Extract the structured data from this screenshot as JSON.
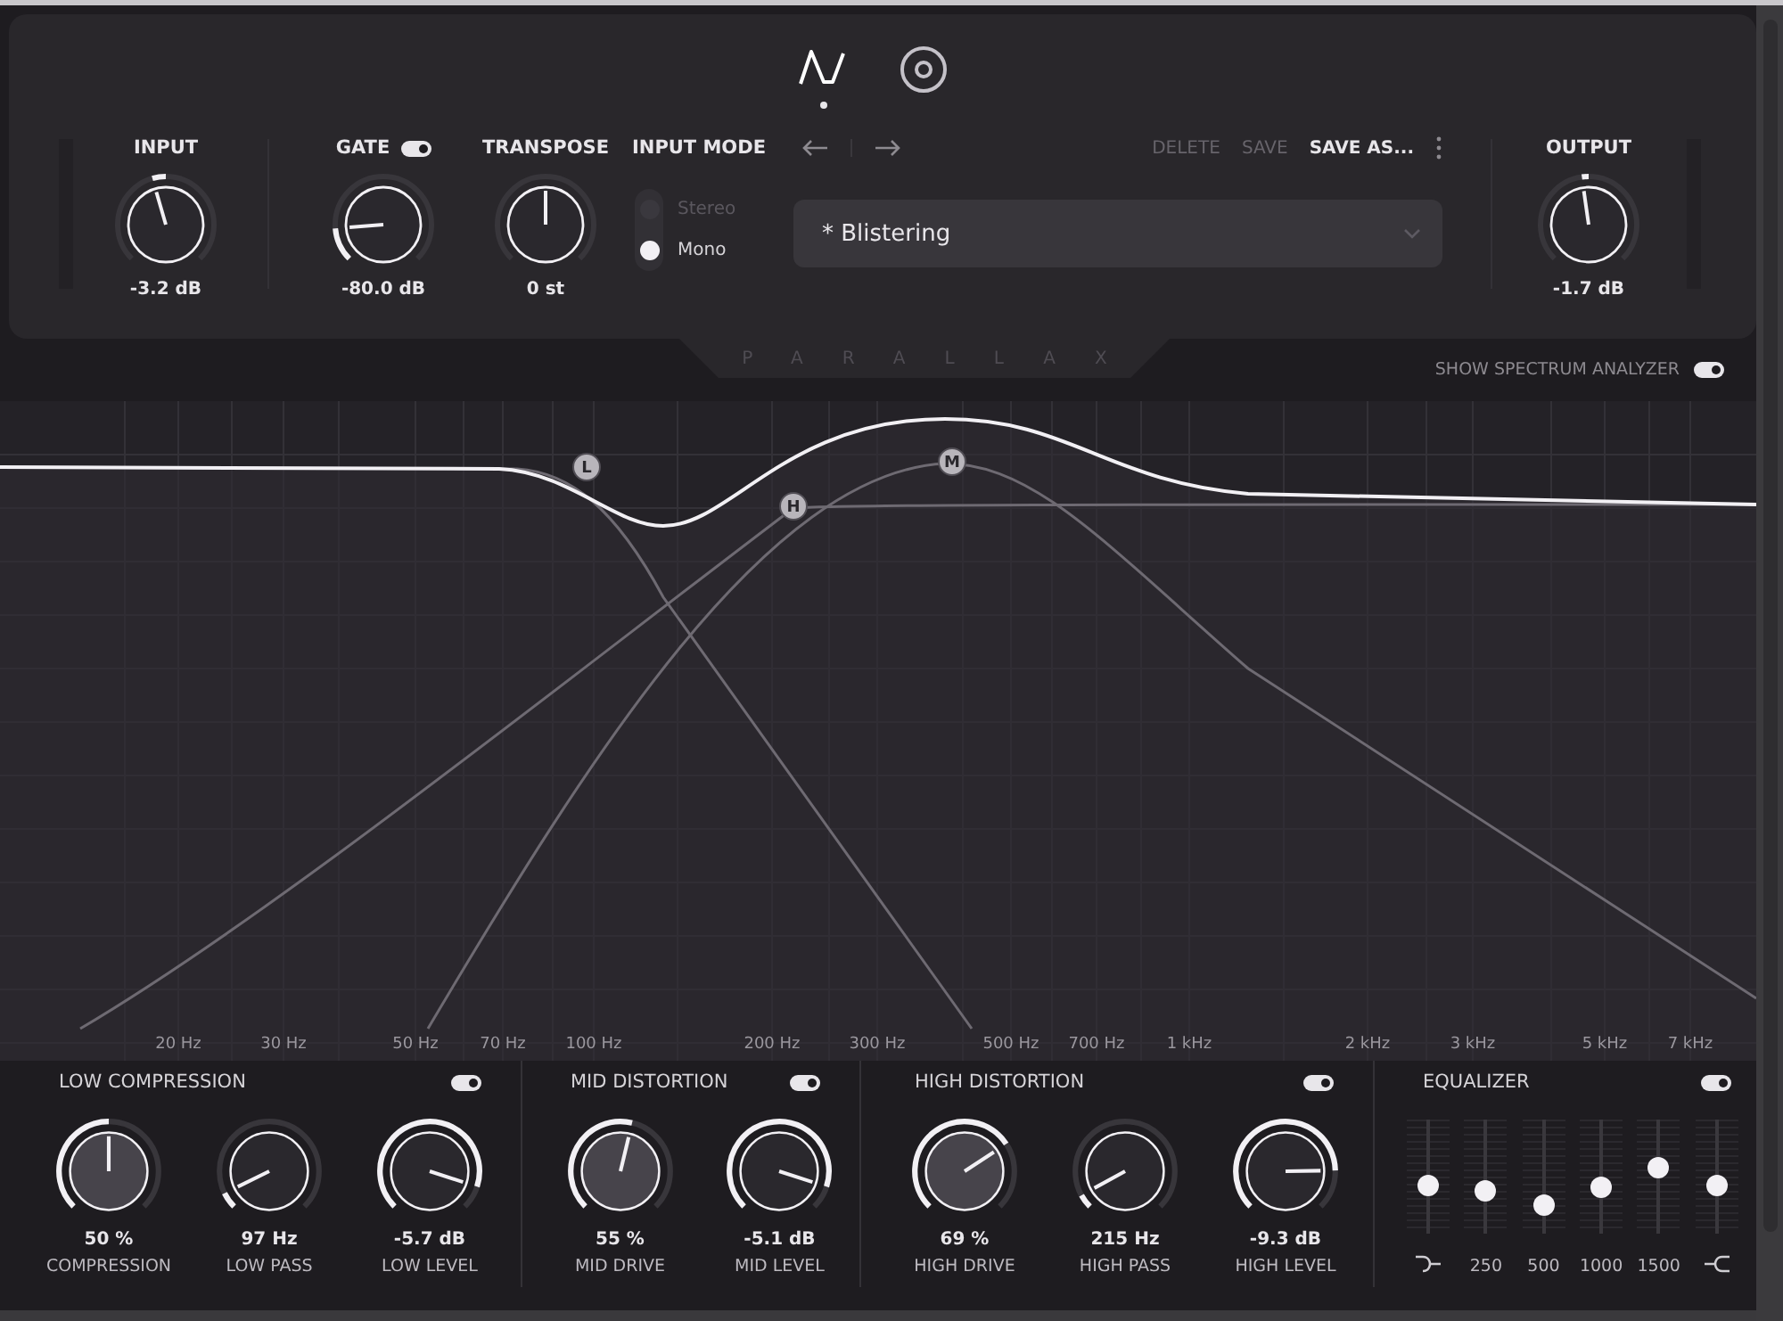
{
  "views": [
    {
      "kind": "wave",
      "selected": true
    },
    {
      "kind": "target",
      "selected": false
    }
  ],
  "gate_switch": {
    "on": true
  },
  "input_knobs": [
    {
      "label": "INPUT",
      "value": "-3.2 dB",
      "kind": "bipolar"
    },
    {
      "label": "GATE",
      "value": "-80.0 dB",
      "kind": "unipolar"
    },
    {
      "label": "TRANSPOSE",
      "value": "0 st",
      "kind": "bipolar"
    }
  ],
  "input_mode": {
    "label": "INPUT MODE",
    "options": [
      {
        "label": "Stereo",
        "selected": false
      },
      {
        "label": "Mono",
        "selected": true
      }
    ]
  },
  "preset": {
    "name": "* Blistering",
    "actions": [
      {
        "label": "DELETE",
        "disabled": true
      },
      {
        "label": "SAVE",
        "disabled": true
      },
      {
        "label": "SAVE AS...",
        "disabled": false
      }
    ]
  },
  "output_knob": {
    "label": "OUTPUT",
    "value": "-1.7 dB",
    "kind": "bipolar"
  },
  "brand": "PARALLAX",
  "spectrum_toggle": {
    "label": "SHOW SPECTRUM ANALYZER",
    "on": true
  },
  "graph": {
    "bands": [
      {
        "label": "L"
      },
      {
        "label": "H"
      },
      {
        "label": "M"
      }
    ],
    "frequency_labels": [
      "20 Hz",
      "30 Hz",
      "50 Hz",
      "70 Hz",
      "100 Hz",
      "200 Hz",
      "300 Hz",
      "500 Hz",
      "700 Hz",
      "1 kHz",
      "2 kHz",
      "3 kHz",
      "5 kHz",
      "7 kHz"
    ]
  },
  "sections": [
    {
      "title": "LOW COMPRESSION",
      "on": true,
      "knobs": [
        {
          "value": "50 %",
          "label": "COMPRESSION",
          "kind": "amount"
        },
        {
          "value": "97 Hz",
          "label": "LOW PASS",
          "kind": "unipolar"
        },
        {
          "value": "-5.7 dB",
          "label": "LOW LEVEL",
          "kind": "unipolar"
        }
      ]
    },
    {
      "title": "MID DISTORTION",
      "on": true,
      "knobs": [
        {
          "value": "55 %",
          "label": "MID DRIVE",
          "kind": "amount"
        },
        {
          "value": "-5.1 dB",
          "label": "MID LEVEL",
          "kind": "unipolar"
        }
      ]
    },
    {
      "title": "HIGH DISTORTION",
      "on": true,
      "knobs": [
        {
          "value": "69 %",
          "label": "HIGH DRIVE",
          "kind": "amount"
        },
        {
          "value": "215 Hz",
          "label": "HIGH PASS",
          "kind": "unipolar"
        },
        {
          "value": "-9.3 dB",
          "label": "HIGH LEVEL",
          "kind": "unipolar"
        }
      ]
    }
  ],
  "equalizer": {
    "title": "EQUALIZER",
    "on": true,
    "bands": [
      {
        "kind": "low-shelf",
        "level": 0.4
      },
      {
        "kind": "band",
        "label": "250",
        "level": 0.35
      },
      {
        "kind": "band",
        "label": "500",
        "level": 0.19
      },
      {
        "kind": "band",
        "label": "1000",
        "level": 0.38
      },
      {
        "kind": "band",
        "label": "1500",
        "level": 0.6
      },
      {
        "kind": "high-shelf",
        "level": 0.4
      }
    ]
  }
}
